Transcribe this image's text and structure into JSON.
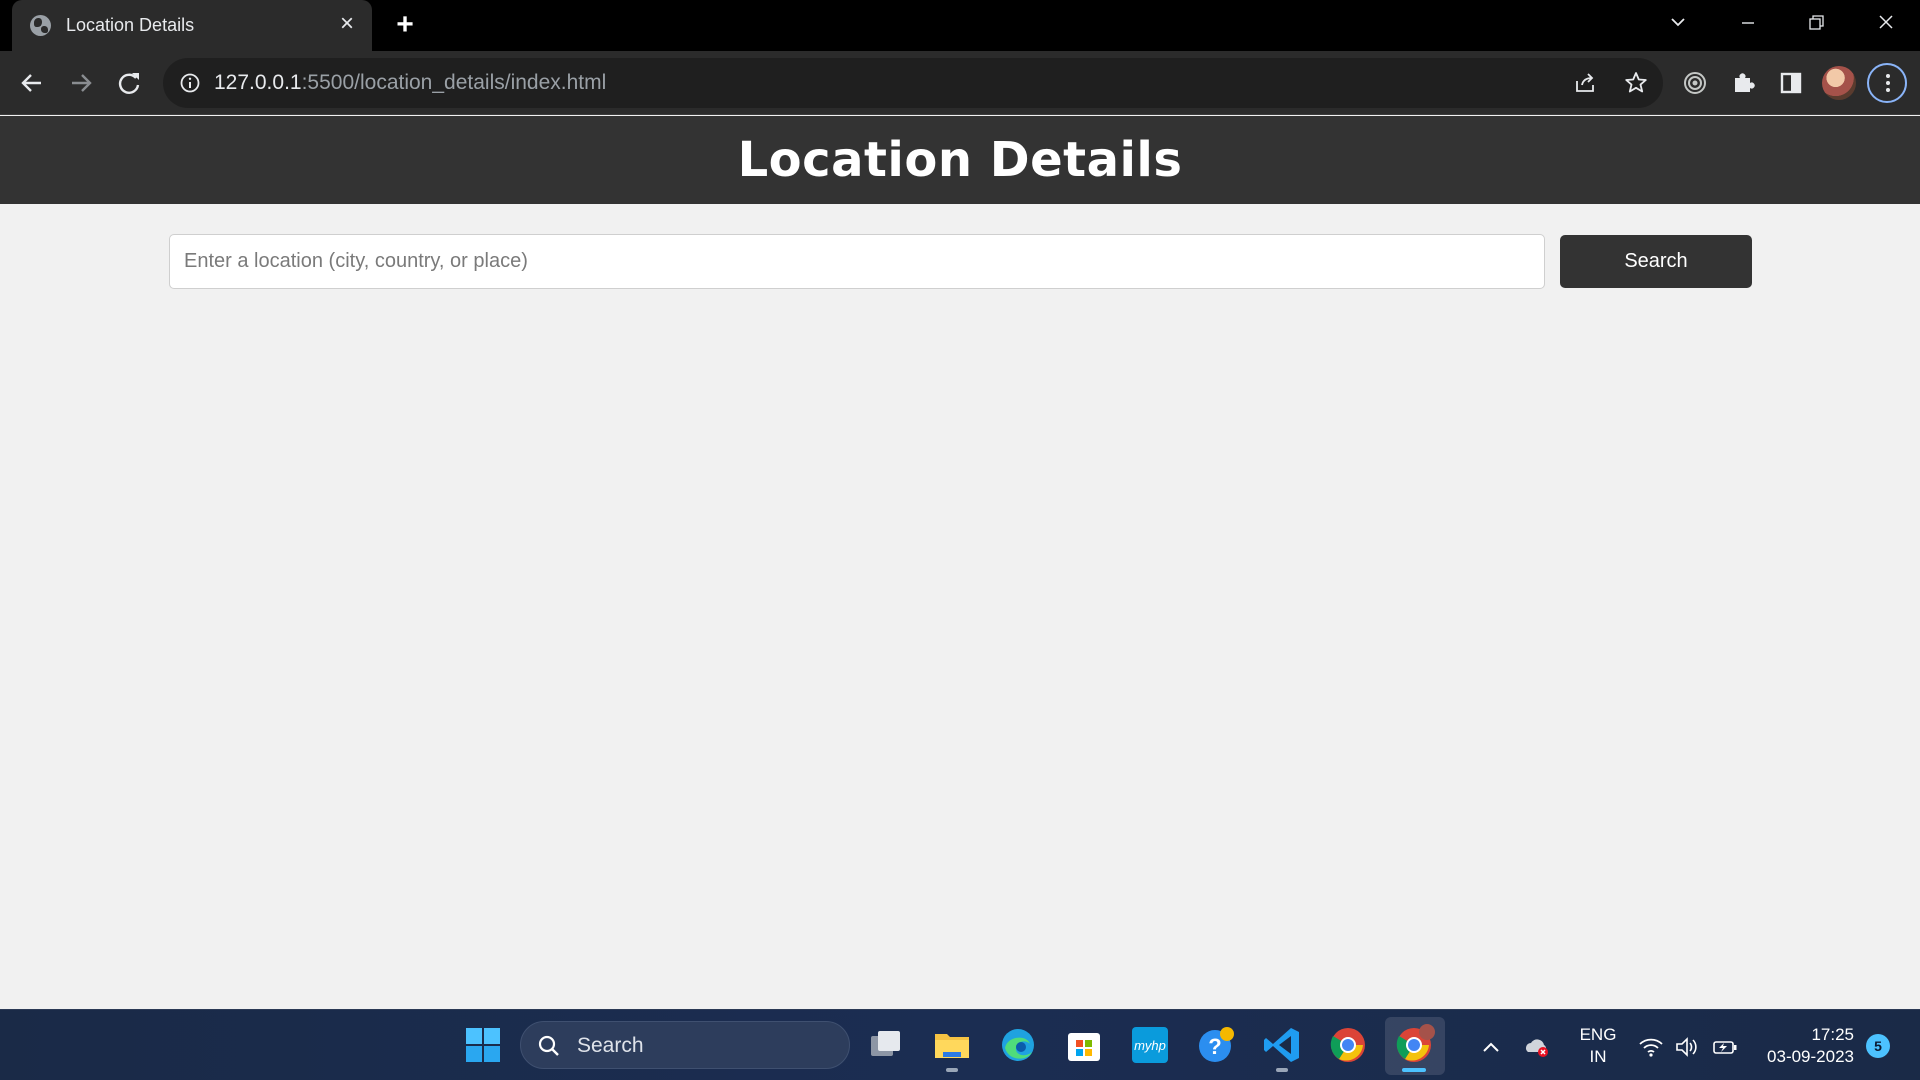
{
  "browser": {
    "tab_title": "Location Details",
    "url_host": "127.0.0.1",
    "url_rest": ":5500/location_details/index.html"
  },
  "page": {
    "title": "Location Details",
    "search_placeholder": "Enter a location (city, country, or place)",
    "search_value": "",
    "search_button": "Search"
  },
  "taskbar": {
    "search_label": "Search",
    "lang_line1": "ENG",
    "lang_line2": "IN",
    "time": "17:25",
    "date": "03-09-2023",
    "notification_count": "5"
  },
  "colors": {
    "header_bg": "#333333",
    "page_bg": "#f1f1f1",
    "button_bg": "#333333",
    "accent_ring": "#8ab4f8"
  }
}
